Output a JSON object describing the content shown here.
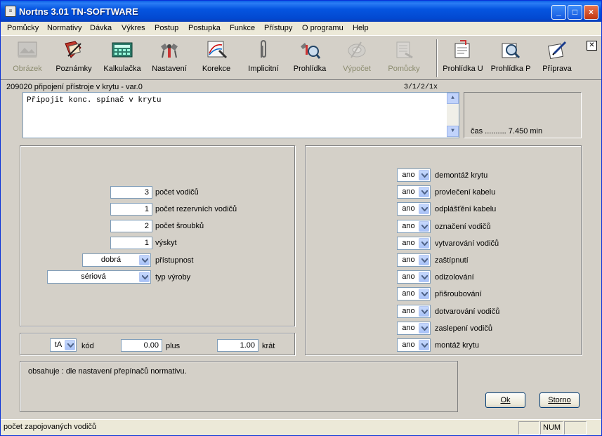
{
  "window": {
    "title": "Nortns 3.01 TN-SOFTWARE",
    "minimize": "_",
    "maximize": "□",
    "close": "×"
  },
  "menu": [
    "Pomůcky",
    "Normativy",
    "Dávka",
    "Výkres",
    "Postup",
    "Postupka",
    "Funkce",
    "Přístupy",
    "O programu",
    "Help"
  ],
  "toolbar": {
    "items": [
      {
        "label": "Obrázek",
        "icon": "image-icon",
        "enabled": false
      },
      {
        "label": "Poznámky",
        "icon": "notes-icon",
        "enabled": true
      },
      {
        "label": "Kalkulačka",
        "icon": "calculator-icon",
        "enabled": true
      },
      {
        "label": "Nastavení",
        "icon": "settings-icon",
        "enabled": true
      },
      {
        "label": "Korekce",
        "icon": "correction-icon",
        "enabled": true
      },
      {
        "label": "Implicitní",
        "icon": "paperclip-icon",
        "enabled": true
      },
      {
        "label": "Prohlídka",
        "icon": "inspect-icon",
        "enabled": true
      },
      {
        "label": "Výpočet",
        "icon": "calculate-icon",
        "enabled": false
      },
      {
        "label": "Pomůcky",
        "icon": "tools-icon",
        "enabled": false
      },
      {
        "label": "Prohlídka U",
        "icon": "inspect-u-icon",
        "enabled": true
      },
      {
        "label": "Prohlídka P",
        "icon": "inspect-p-icon",
        "enabled": true
      },
      {
        "label": "Příprava",
        "icon": "prepare-icon",
        "enabled": true
      }
    ],
    "close_label": "✕"
  },
  "item": {
    "title": "209020 připojení přístroje v krytu - var.0",
    "code": "3/1/2/1x",
    "description": "Připojit konc. spínač v krytu",
    "time": "čas .......... 7.450 min"
  },
  "params": [
    {
      "value": "3",
      "label": "počet vodičů"
    },
    {
      "value": "1",
      "label": "počet rezervních vodičů"
    },
    {
      "value": "2",
      "label": "počet šroubků"
    },
    {
      "value": "1",
      "label": "výskyt"
    }
  ],
  "access": {
    "value": "dobrá",
    "label": "přístupnost"
  },
  "production": {
    "value": "sériová",
    "label": "typ výroby"
  },
  "code_row": {
    "code_value": "tA",
    "code_label": "kód",
    "plus_value": "0.00",
    "plus_label": "plus",
    "times_value": "1.00",
    "times_label": "krát"
  },
  "operations": [
    {
      "value": "ano",
      "label": "demontáž krytu"
    },
    {
      "value": "ano",
      "label": "provlečení kabelu"
    },
    {
      "value": "ano",
      "label": "odplášťění kabelu"
    },
    {
      "value": "ano",
      "label": "označení vodičů"
    },
    {
      "value": "ano",
      "label": "vytvarování vodičů"
    },
    {
      "value": "ano",
      "label": "zaštípnutí"
    },
    {
      "value": "ano",
      "label": "odizolování"
    },
    {
      "value": "ano",
      "label": "přišroubování"
    },
    {
      "value": "ano",
      "label": "dotvarování vodičů"
    },
    {
      "value": "ano",
      "label": "zaslepení vodičů"
    },
    {
      "value": "ano",
      "label": "montáž krytu"
    }
  ],
  "info": "obsahuje : dle nastavení přepínačů normativu.",
  "buttons": {
    "ok": "Ok",
    "cancel": "Storno"
  },
  "status": {
    "text": "počet zapojovaných vodičů",
    "num": "NUM"
  }
}
